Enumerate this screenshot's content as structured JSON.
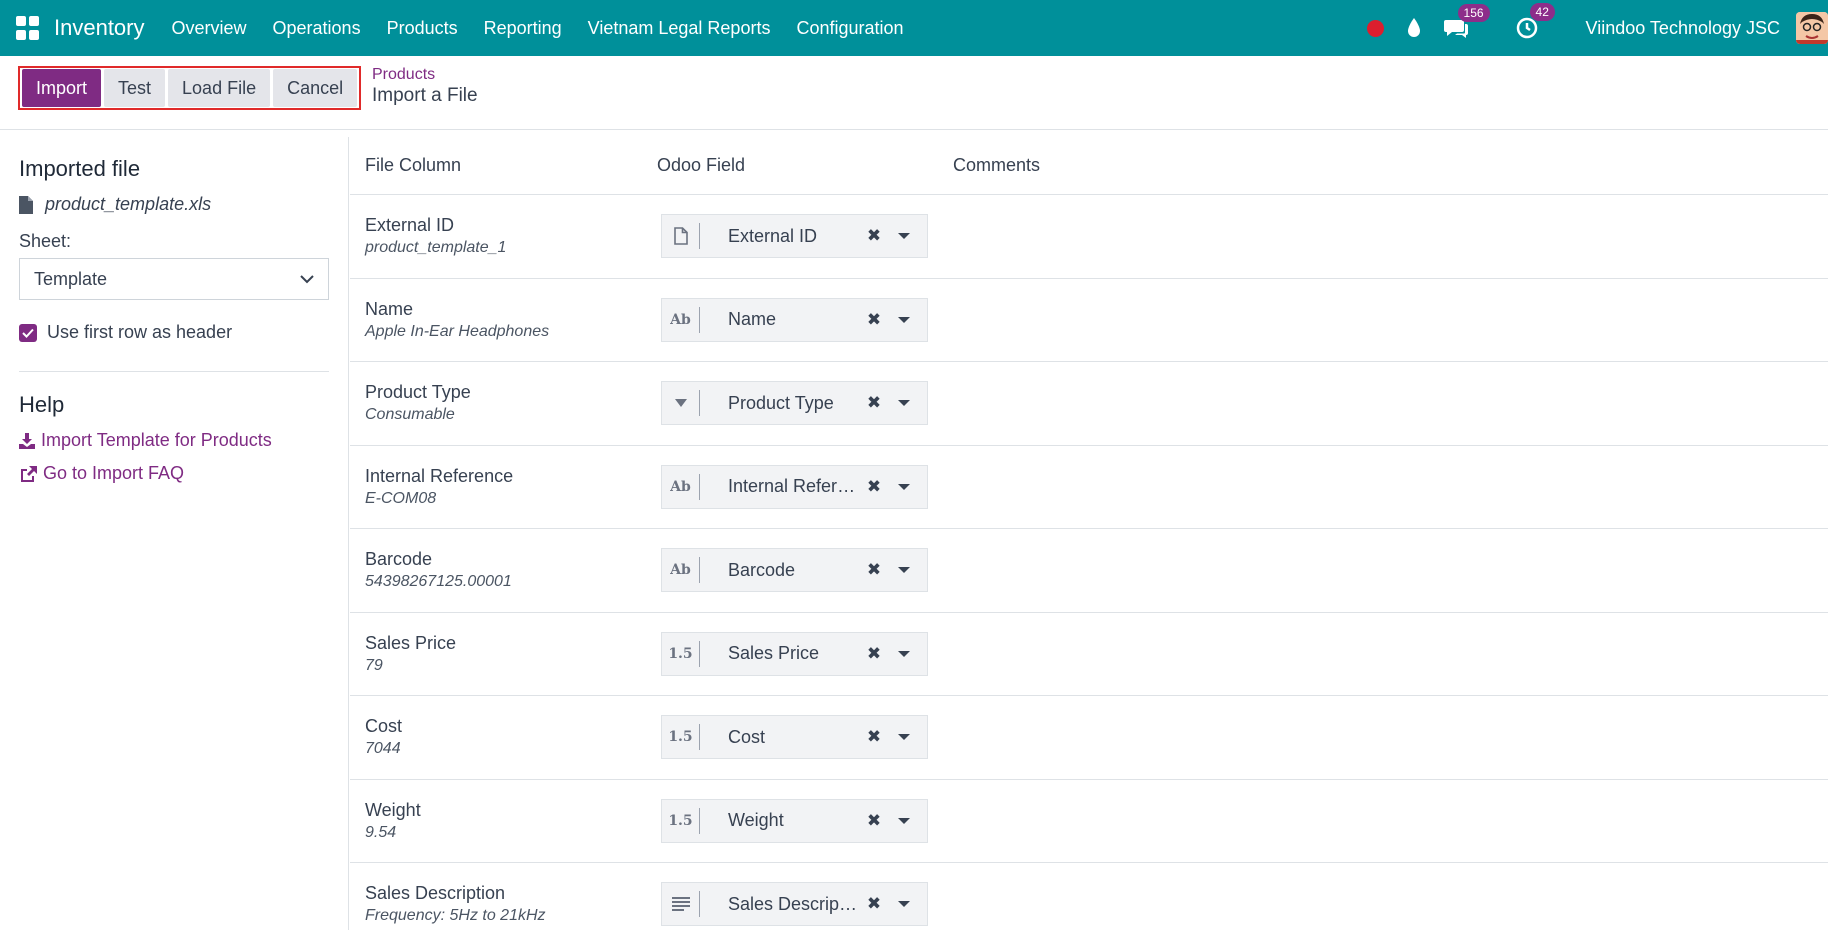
{
  "navbar": {
    "app_name": "Inventory",
    "menu": [
      "Overview",
      "Operations",
      "Products",
      "Reporting",
      "Vietnam Legal Reports",
      "Configuration"
    ],
    "messages_count": "156",
    "activities_count": "42",
    "company": "Viindoo Technology JSC",
    "color": "#00909a"
  },
  "control_panel": {
    "buttons": {
      "import": "Import",
      "test": "Test",
      "load_file": "Load File",
      "cancel": "Cancel"
    },
    "breadcrumb": {
      "parent": "Products",
      "current": "Import a File"
    }
  },
  "sidebar": {
    "imported_file_title": "Imported file",
    "file_name": "product_template.xls",
    "sheet_label": "Sheet:",
    "sheet_value": "Template",
    "use_header_label": "Use first row as header",
    "use_header_checked": true,
    "help_title": "Help",
    "help_links": {
      "template": "Import Template for Products",
      "faq": "Go to Import FAQ"
    }
  },
  "table": {
    "headers": {
      "file_column": "File Column",
      "odoo_field": "Odoo Field",
      "comments": "Comments"
    },
    "rows": [
      {
        "name": "External ID",
        "sample": "product_template_1",
        "field": "External ID",
        "type": "file-icon"
      },
      {
        "name": "Name",
        "sample": "Apple In-Ear Headphones",
        "field": "Name",
        "type": "Ab"
      },
      {
        "name": "Product Type",
        "sample": "Consumable",
        "field": "Product Type",
        "type": "selection-icon"
      },
      {
        "name": "Internal Reference",
        "sample": "E-COM08",
        "field": "Internal Reference",
        "type": "Ab"
      },
      {
        "name": "Barcode",
        "sample": "54398267125.00001",
        "field": "Barcode",
        "type": "Ab"
      },
      {
        "name": "Sales Price",
        "sample": "79",
        "field": "Sales Price",
        "type": "1.5"
      },
      {
        "name": "Cost",
        "sample": "7044",
        "field": "Cost",
        "type": "1.5"
      },
      {
        "name": "Weight",
        "sample": "9.54",
        "field": "Weight",
        "type": "1.5"
      },
      {
        "name": "Sales Description",
        "sample": "Frequency: 5Hz to 21kHz",
        "field": "Sales Description",
        "type": "text-icon"
      }
    ]
  },
  "colors": {
    "brand": "#7f2b83",
    "highlight": "#e02a2a"
  }
}
